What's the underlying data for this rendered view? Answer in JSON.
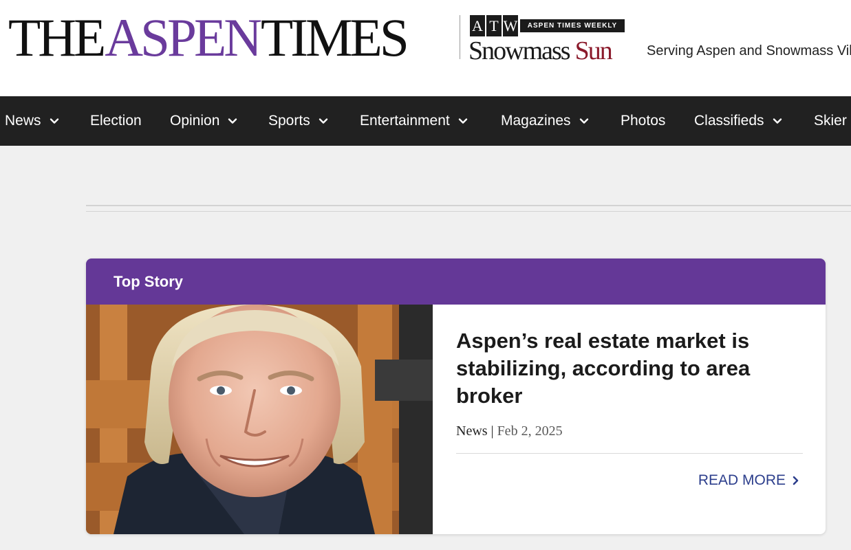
{
  "masthead": {
    "logo_the": "THE",
    "logo_aspen": "ASPEN",
    "logo_times": "TIMES",
    "atw_letters": [
      "A",
      "T",
      "W"
    ],
    "atw_weekly": "ASPEN TIMES WEEKLY",
    "snowmass": "Snowmass",
    "sun": "Sun",
    "tagline": "Serving Aspen and Snowmass Village"
  },
  "nav": {
    "items": [
      {
        "label": "News",
        "has_dropdown": true
      },
      {
        "label": "Election",
        "has_dropdown": false
      },
      {
        "label": "Opinion",
        "has_dropdown": true
      },
      {
        "label": "Sports",
        "has_dropdown": true
      },
      {
        "label": "Entertainment",
        "has_dropdown": true
      },
      {
        "label": "Magazines",
        "has_dropdown": true
      },
      {
        "label": "Photos",
        "has_dropdown": false
      },
      {
        "label": "Classifieds",
        "has_dropdown": true
      },
      {
        "label": "Skier",
        "has_dropdown": false
      }
    ]
  },
  "top_story": {
    "header": "Top Story",
    "headline": "Aspen’s real estate market is stabilizing, according to area broker",
    "category": "News",
    "separator": "|",
    "date": "Feb 2, 2025",
    "read_more": "READ MORE"
  },
  "colors": {
    "brand_purple": "#643897",
    "nav_background": "#212121",
    "link_blue": "#2c3e8c",
    "sun_red": "#8b1a2b"
  },
  "icons": {
    "nav_dropdown": "chevron-down-icon",
    "read_more": "chevron-right-icon"
  }
}
